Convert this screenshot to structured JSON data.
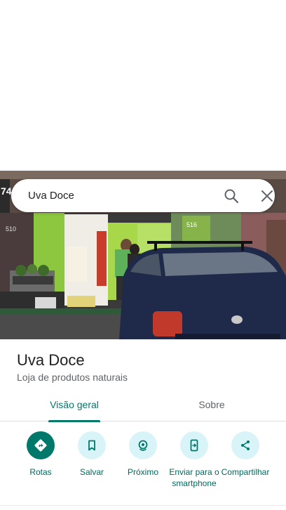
{
  "search": {
    "query": "Uva Doce",
    "search_icon": "search-icon",
    "close_icon": "close-icon"
  },
  "photo": {
    "sign_number_left": "74",
    "wall_number_left": "510",
    "wall_number_right": "516"
  },
  "place": {
    "name": "Uva Doce",
    "category": "Loja de produtos naturais"
  },
  "tabs": [
    {
      "label": "Visão geral",
      "active": true
    },
    {
      "label": "Sobre",
      "active": false
    }
  ],
  "actions": [
    {
      "label": "Rotas",
      "icon": "directions-icon"
    },
    {
      "label": "Salvar",
      "icon": "bookmark-icon"
    },
    {
      "label": "Próximo",
      "icon": "nearby-icon"
    },
    {
      "label": "Enviar para o smartphone",
      "icon": "send-to-phone-icon"
    },
    {
      "label": "Compartilhar",
      "icon": "share-icon"
    }
  ],
  "colors": {
    "accent": "#00796b",
    "action_bg": "#d9f4f8",
    "text_primary": "#202124",
    "text_secondary": "#5f6368"
  }
}
